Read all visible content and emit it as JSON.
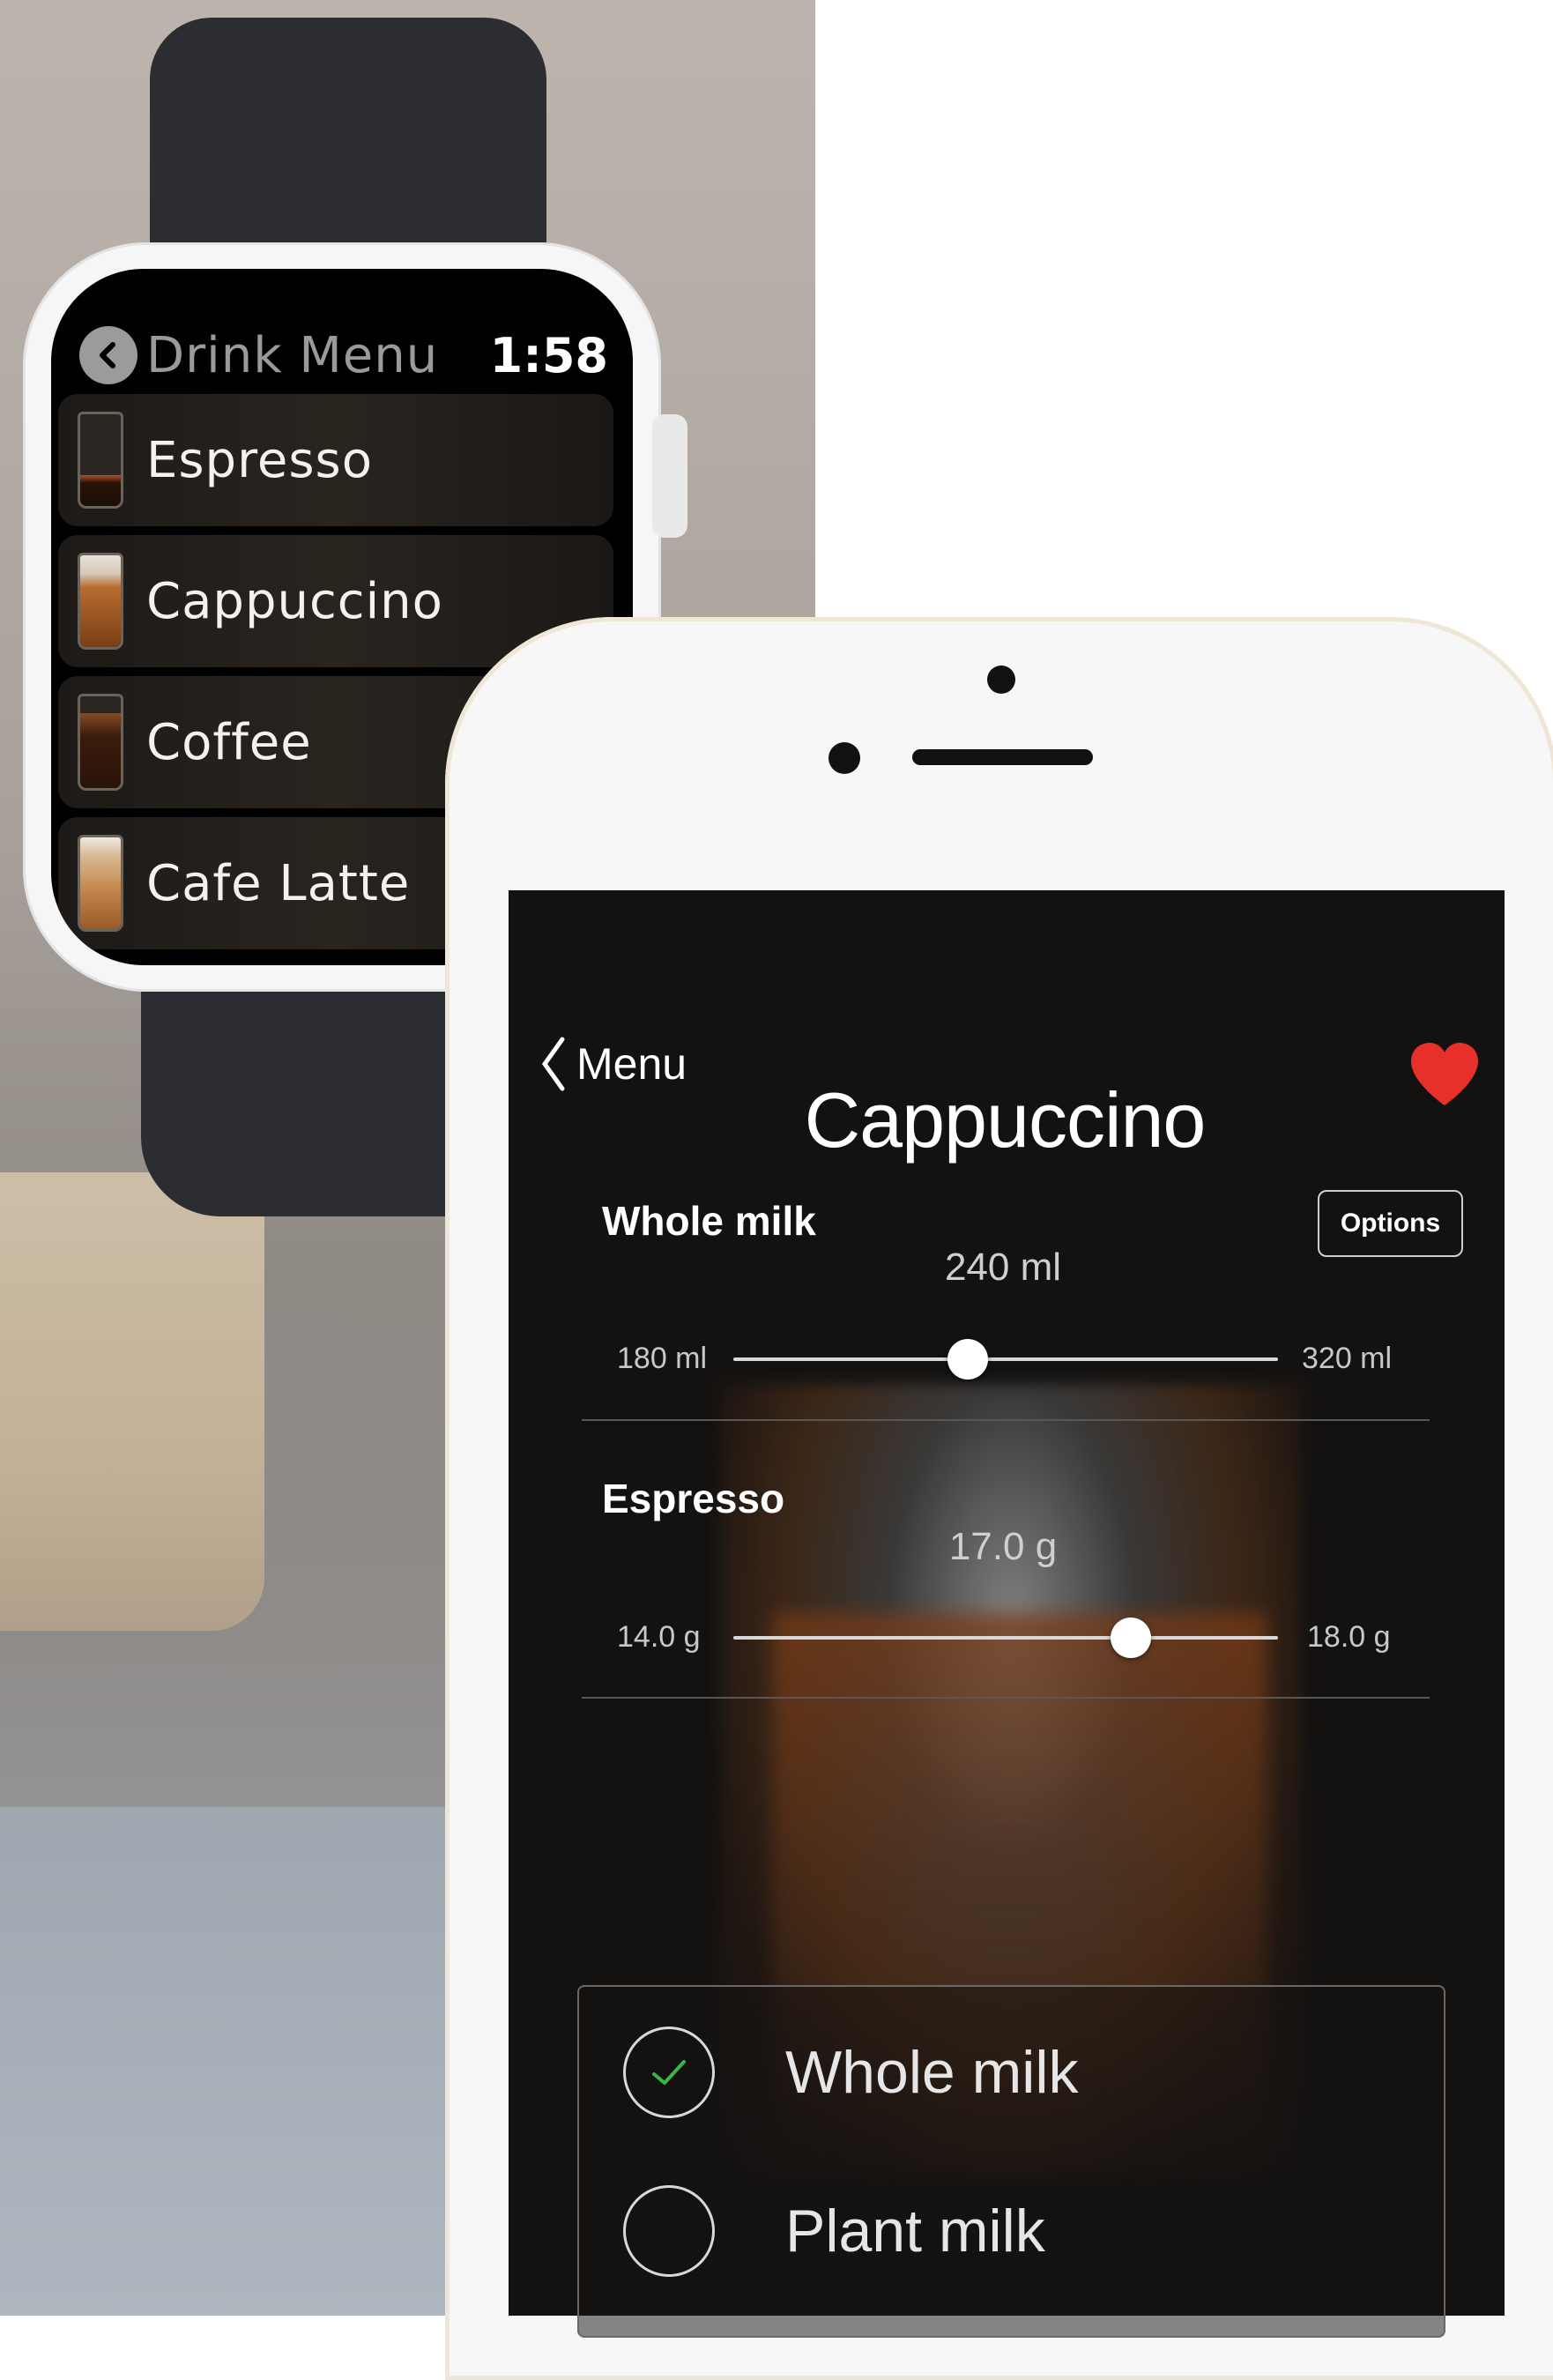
{
  "watch": {
    "header_title": "Drink Menu",
    "time": "1:58",
    "items": [
      {
        "label": "Espresso",
        "icon": "espresso-glass-icon"
      },
      {
        "label": "Cappuccino",
        "icon": "cappuccino-glass-icon"
      },
      {
        "label": "Coffee",
        "icon": "coffee-glass-icon"
      },
      {
        "label": "Cafe Latte",
        "icon": "latte-glass-icon"
      }
    ]
  },
  "phone": {
    "back_label": "Menu",
    "title": "Cappuccino",
    "favorite": true,
    "options_label": "Options",
    "milk_slider": {
      "label": "Whole milk",
      "value": "240 ml",
      "min_label": "180 ml",
      "max_label": "320 ml",
      "fraction": 0.43
    },
    "espresso_slider": {
      "label": "Espresso",
      "value": "17.0 g",
      "min_label": "14.0 g",
      "max_label": "18.0 g",
      "fraction": 0.73
    },
    "milk_options": [
      {
        "label": "Whole milk",
        "selected": true
      },
      {
        "label": "Plant milk",
        "selected": false
      }
    ]
  },
  "colors": {
    "accent_heart": "#e8302b",
    "check": "#3bb54a"
  }
}
